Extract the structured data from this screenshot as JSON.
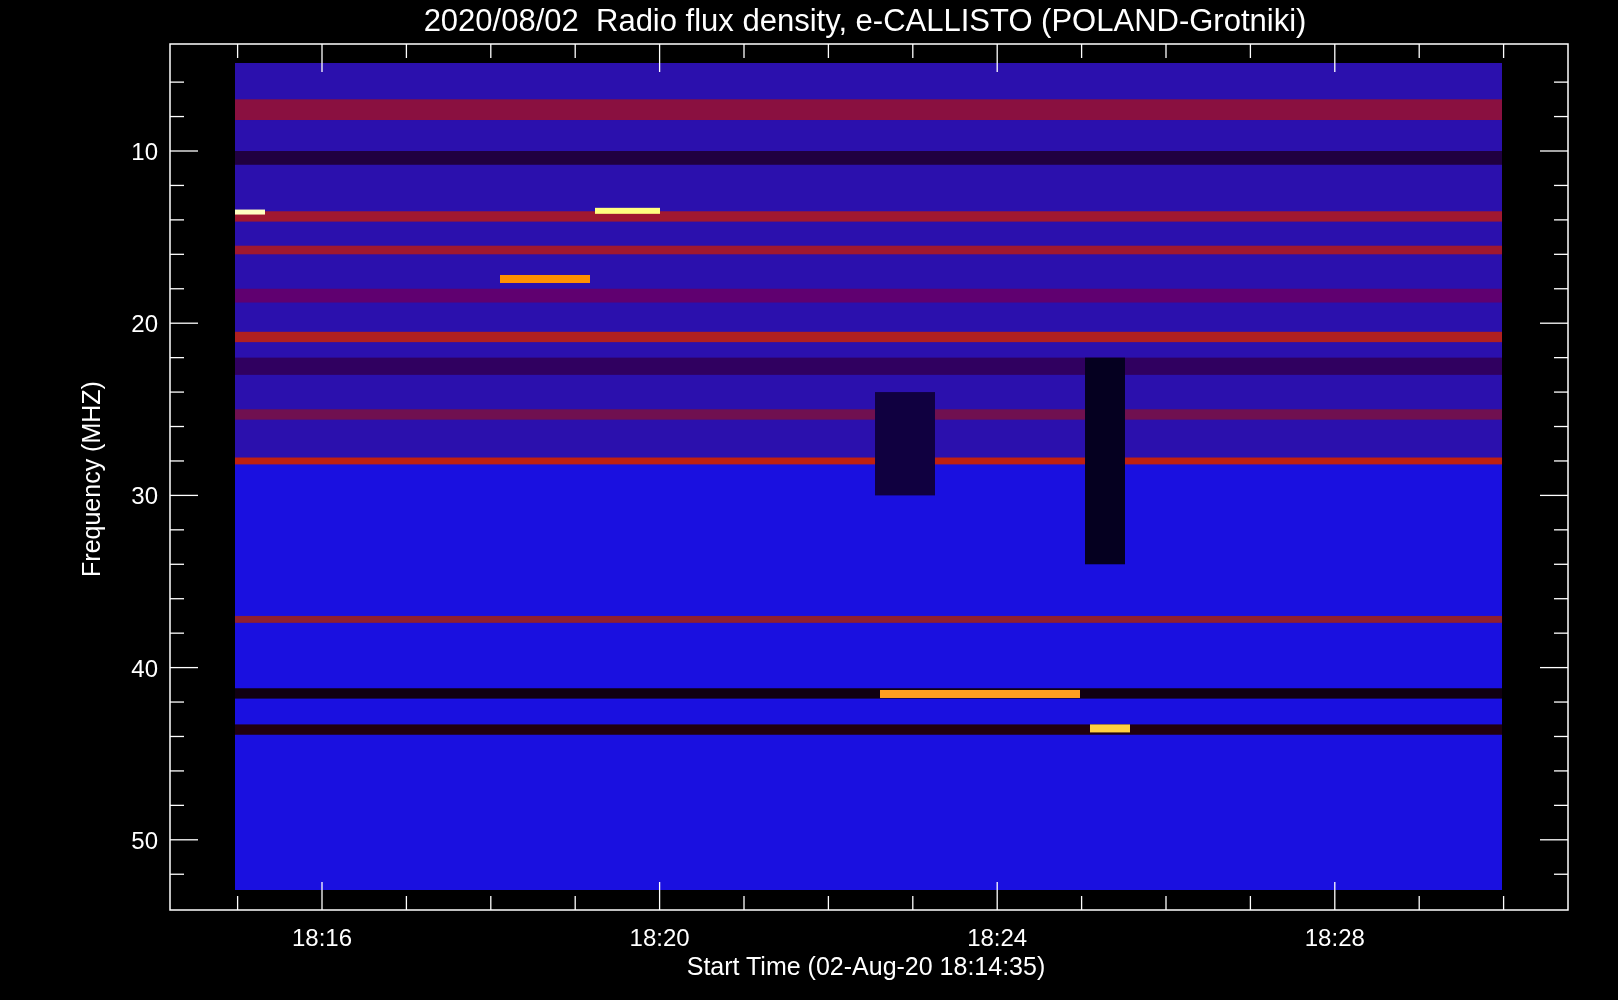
{
  "title": "2020/08/02  Radio flux density, e-CALLISTO (POLAND-Grotniki)",
  "plot": {
    "ylabel": "Frequency (MHZ)",
    "xlabel": "Start Time (02-Aug-20 18:14:35)",
    "yticks": [
      "10",
      "20",
      "30",
      "40",
      "50"
    ],
    "xticks": [
      "18:16",
      "18:20",
      "18:24",
      "18:28"
    ]
  }
}
